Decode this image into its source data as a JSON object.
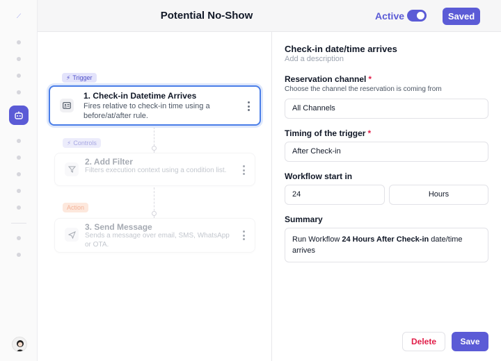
{
  "header": {
    "title": "Potential No-Show",
    "active_label": "Active",
    "active_on": true,
    "saved_label": "Saved"
  },
  "sidebar": {
    "icons": [
      "logo-icon",
      "nav-dot",
      "nav-dot",
      "nav-dot",
      "bot-icon",
      "nav-dot",
      "nav-dot",
      "nav-dot",
      "nav-dot",
      "nav-dot",
      "nav-dot",
      "avatar"
    ]
  },
  "workflow": {
    "trigger_pill": "Trigger",
    "controls_pill": "Controls",
    "action_pill": "Action",
    "nodes": [
      {
        "title": "1. Check-in Datetime Arrives",
        "description": "Fires relative to check-in time using a before/at/after rule.",
        "icon": "id-card-icon"
      },
      {
        "title": "2. Add Filter",
        "description": "Filters execution context using a condition list.",
        "icon": "filter-icon"
      },
      {
        "title": "3. Send Message",
        "description": "Sends a message over email, SMS, WhatsApp or OTA.",
        "icon": "send-icon"
      }
    ]
  },
  "panel": {
    "title": "Check-in date/time arrives",
    "description": "Add a description",
    "channel_label": "Reservation channel",
    "required_mark": "*",
    "channel_help": "Choose the channel the reservation is coming from",
    "channel_value": "All Channels",
    "timing_label": "Timing of the trigger",
    "timing_value": "After Check-in",
    "start_label": "Workflow start in",
    "start_amount": "24",
    "start_unit": "Hours",
    "summary_label": "Summary",
    "summary_prefix": "Run Workflow",
    "summary_bold": "24 Hours After Check-in",
    "summary_suffix": "date/time arrives",
    "delete_label": "Delete",
    "save_label": "Save"
  },
  "colors": {
    "accent": "#5b5bd6",
    "selected_border": "#4a7ee8",
    "danger": "#e11d48"
  }
}
